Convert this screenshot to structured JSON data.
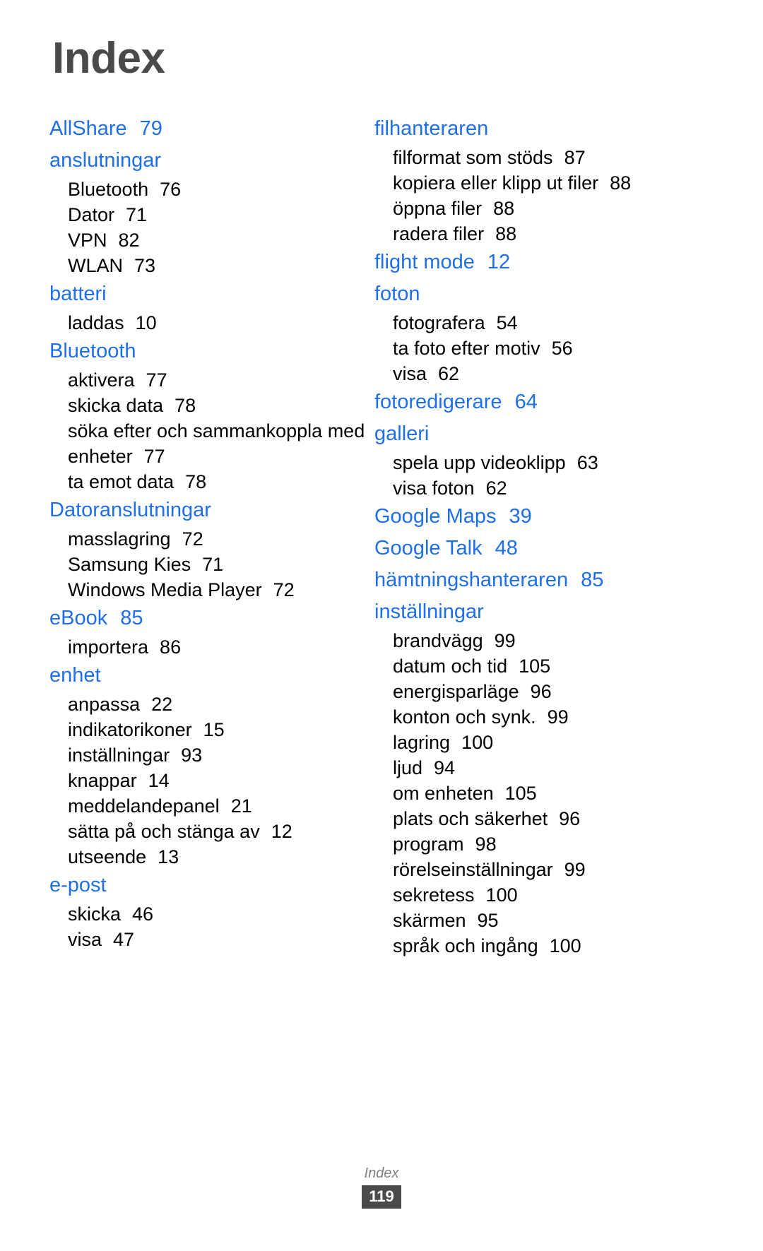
{
  "document": {
    "title": "Index",
    "accent_color": "#1f6fe8",
    "title_color": "#4a4a4a"
  },
  "footer": {
    "label": "Index",
    "page_number": "119"
  },
  "columns": [
    {
      "id": "left",
      "groups": [
        {
          "head": "AllShare",
          "head_page": "79",
          "subs": []
        },
        {
          "head": "anslutningar",
          "head_page": "",
          "subs": [
            {
              "label": "Bluetooth",
              "page": "76"
            },
            {
              "label": "Dator",
              "page": "71"
            },
            {
              "label": "VPN",
              "page": "82"
            },
            {
              "label": "WLAN",
              "page": "73"
            }
          ]
        },
        {
          "head": "batteri",
          "head_page": "",
          "subs": [
            {
              "label": "laddas",
              "page": "10"
            }
          ]
        },
        {
          "head": "Bluetooth",
          "head_page": "",
          "subs": [
            {
              "label": "aktivera",
              "page": "77"
            },
            {
              "label": "skicka data",
              "page": "78"
            },
            {
              "label": "söka efter och sammankoppla med enheter",
              "page": "77",
              "wrap": true
            },
            {
              "label": "ta emot data",
              "page": "78"
            }
          ]
        },
        {
          "head": "Datoranslutningar",
          "head_page": "",
          "subs": [
            {
              "label": "masslagring",
              "page": "72"
            },
            {
              "label": "Samsung Kies",
              "page": "71"
            },
            {
              "label": "Windows Media Player",
              "page": "72"
            }
          ]
        },
        {
          "head": "eBook",
          "head_page": "85",
          "subs": [
            {
              "label": "importera",
              "page": "86"
            }
          ]
        },
        {
          "head": "enhet",
          "head_page": "",
          "subs": [
            {
              "label": "anpassa",
              "page": "22"
            },
            {
              "label": "indikatorikoner",
              "page": "15"
            },
            {
              "label": "inställningar",
              "page": "93"
            },
            {
              "label": "knappar",
              "page": "14"
            },
            {
              "label": "meddelandepanel",
              "page": "21"
            },
            {
              "label": "sätta på och stänga av",
              "page": "12"
            },
            {
              "label": "utseende",
              "page": "13"
            }
          ]
        },
        {
          "head": "e-post",
          "head_page": "",
          "subs": [
            {
              "label": "skicka",
              "page": "46"
            },
            {
              "label": "visa",
              "page": "47"
            }
          ]
        }
      ]
    },
    {
      "id": "right",
      "groups": [
        {
          "head": "filhanteraren",
          "head_page": "",
          "subs": [
            {
              "label": "filformat som stöds",
              "page": "87"
            },
            {
              "label": "kopiera eller klipp ut filer",
              "page": "88",
              "wrap": true
            },
            {
              "label": "öppna filer",
              "page": "88"
            },
            {
              "label": "radera filer",
              "page": "88"
            }
          ]
        },
        {
          "head": "flight mode",
          "head_page": "12",
          "subs": []
        },
        {
          "head": "foton",
          "head_page": "",
          "subs": [
            {
              "label": "fotografera",
              "page": "54"
            },
            {
              "label": "ta foto efter motiv",
              "page": "56"
            },
            {
              "label": "visa",
              "page": "62"
            }
          ]
        },
        {
          "head": "fotoredigerare",
          "head_page": "64",
          "subs": []
        },
        {
          "head": "galleri",
          "head_page": "",
          "subs": [
            {
              "label": "spela upp videoklipp",
              "page": "63"
            },
            {
              "label": "visa foton",
              "page": "62"
            }
          ]
        },
        {
          "head": "Google Maps",
          "head_page": "39",
          "subs": []
        },
        {
          "head": "Google Talk",
          "head_page": "48",
          "subs": []
        },
        {
          "head": "hämtningshanteraren",
          "head_page": "85",
          "subs": []
        },
        {
          "head": "inställningar",
          "head_page": "",
          "subs": [
            {
              "label": "brandvägg",
              "page": "99"
            },
            {
              "label": "datum och tid",
              "page": "105"
            },
            {
              "label": "energisparläge",
              "page": "96"
            },
            {
              "label": "konton och synk.",
              "page": "99"
            },
            {
              "label": "lagring",
              "page": "100"
            },
            {
              "label": "ljud",
              "page": "94"
            },
            {
              "label": "om enheten",
              "page": "105"
            },
            {
              "label": "plats och säkerhet",
              "page": "96"
            },
            {
              "label": "program",
              "page": "98"
            },
            {
              "label": "rörelseinställningar",
              "page": "99"
            },
            {
              "label": "sekretess",
              "page": "100"
            },
            {
              "label": "skärmen",
              "page": "95"
            },
            {
              "label": "språk och ingång",
              "page": "100"
            }
          ]
        }
      ]
    }
  ]
}
